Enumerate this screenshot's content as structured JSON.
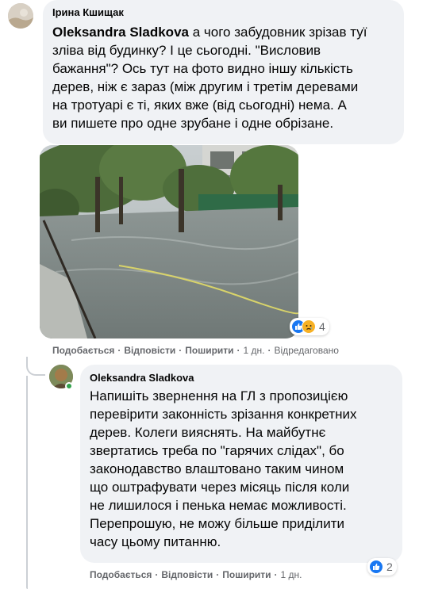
{
  "comment1": {
    "author": "Ірина Кшищак",
    "mention": "Oleksandra Sladkova",
    "text_after_mention": " а чого забудовник зрізав туї\nзліва від будинку? І це сьогодні. \"Висловив\nбажання\"? Ось тут на фото видно іншу кількість\nдерев, ніж є зараз (між другим і третім деревами\nна тротуарі є ті, яких вже (від сьогодні) нема. А\nви пишете про одне зрубане і одне обрізане.",
    "reactions": {
      "icons": [
        "like-icon",
        "sad-icon"
      ],
      "count": "4"
    },
    "actions": {
      "like": "Подобається",
      "reply": "Відповісти",
      "share": "Поширити",
      "time": "1 дн.",
      "edited": "Відредаговано"
    }
  },
  "comment2": {
    "author": "Oleksandra Sladkova",
    "text": "Напишіть звернення на ГЛ з пропозицією\nперевірити законність зрізання конкретних\nдерев. Колеги вияснять. На майбутнє\nзвертатись треба по \"гарячих слідах\", бо\nзаконодавство влаштовано таким чином\nщо оштрафувати через місяць після коли\nне лишилося і пенька немає можливості.\nПерепрошую, не можу більше приділити\nчасу цьому питанню.",
    "reactions": {
      "icons": [
        "like-icon"
      ],
      "count": "2"
    },
    "actions": {
      "like": "Подобається",
      "reply": "Відповісти",
      "share": "Поширити",
      "time": "1 дн."
    }
  },
  "colors": {
    "bubble": "#f0f2f5",
    "meta_text": "#65676b",
    "like_blue": "#1877f2",
    "sad_yellow": "#f7b125",
    "online_green": "#31a24c"
  }
}
